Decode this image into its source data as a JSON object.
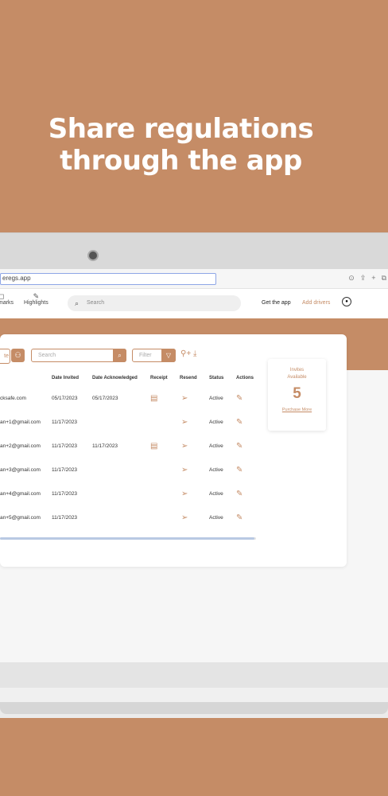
{
  "headline": {
    "line1": "Share regulations",
    "line2": "through the app"
  },
  "browser": {
    "url": "eregs.app",
    "icons": [
      "download-icon",
      "share-icon",
      "new-tab-icon",
      "tabs-icon"
    ]
  },
  "nav": {
    "bookmarks_label": "marks",
    "highlights_label": "Highlights",
    "search_placeholder": "Search",
    "get_app": "Get the app",
    "add_drivers": "Add drivers"
  },
  "toolbar": {
    "partial_button_label": "te",
    "search_placeholder": "Search",
    "filter_placeholder": "Filter"
  },
  "table": {
    "headers": [
      "Date Invited",
      "Date Acknowledged",
      "Receipt",
      "Resend",
      "Status",
      "Actions"
    ],
    "rows": [
      {
        "email": "cksafe.com",
        "invited": "05/17/2023",
        "acknowledged": "05/17/2023",
        "receipt": true,
        "status": "Active"
      },
      {
        "email": "an+1@gmail.com",
        "invited": "11/17/2023",
        "acknowledged": "",
        "receipt": false,
        "status": "Active"
      },
      {
        "email": "an+2@gmail.com",
        "invited": "11/17/2023",
        "acknowledged": "11/17/2023",
        "receipt": true,
        "status": "Active"
      },
      {
        "email": "an+3@gmail.com",
        "invited": "11/17/2023",
        "acknowledged": "",
        "receipt": false,
        "status": "Active"
      },
      {
        "email": "an+4@gmail.com",
        "invited": "11/17/2023",
        "acknowledged": "",
        "receipt": false,
        "status": "Active"
      },
      {
        "email": "an+5@gmail.com",
        "invited": "11/17/2023",
        "acknowledged": "",
        "receipt": false,
        "status": "Active"
      }
    ]
  },
  "invites": {
    "label": "Invites\nAvailable",
    "count": "5",
    "link": "Purchase More"
  },
  "colors": {
    "accent": "#c58c66",
    "background": "#c58c66",
    "url_border": "#8ea6e6"
  }
}
